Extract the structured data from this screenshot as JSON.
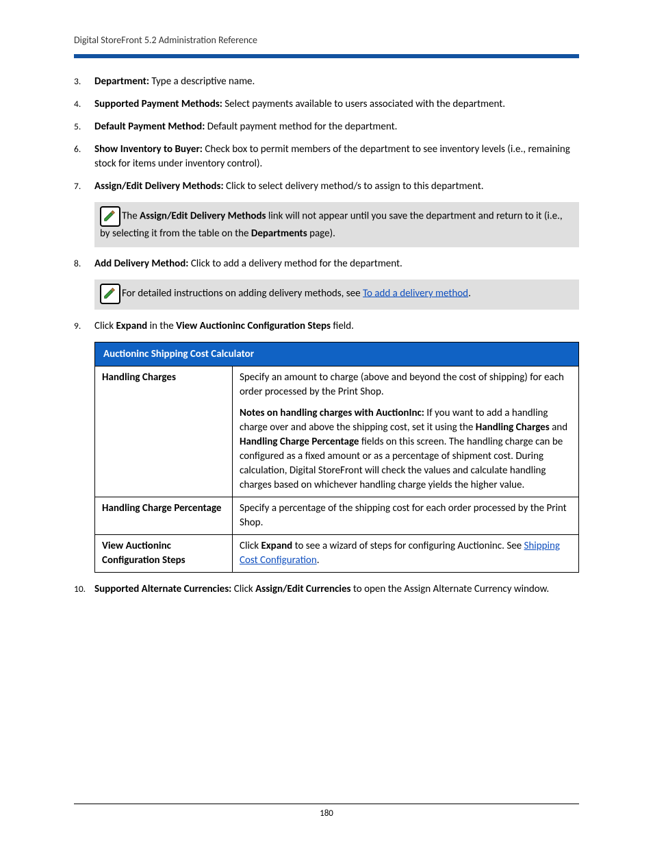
{
  "header": "Digital StoreFront 5.2 Administration Reference",
  "items": {
    "i3": {
      "num": "3.",
      "label": "Department:",
      "text": " Type a descriptive name."
    },
    "i4": {
      "num": "4.",
      "label": "Supported Payment Methods:",
      "text": " Select payments available to users associated with the department."
    },
    "i5": {
      "num": "5.",
      "label": "Default Payment Method:",
      "text": " Default payment method for the department."
    },
    "i6": {
      "num": "6.",
      "label": "Show Inventory to Buyer:",
      "text": " Check box to permit members of the department to see inventory levels (i.e., remaining stock for items under inventory control)."
    },
    "i7": {
      "num": "7.",
      "label": "Assign/Edit Delivery Methods:",
      "text": " Click to select delivery method/s to assign to this department."
    },
    "i8": {
      "num": "8.",
      "label": "Add Delivery Method:",
      "text": " Click to add a delivery method for the department."
    },
    "i9": {
      "num": "9.",
      "pre": "Click ",
      "b1": "Expand",
      "mid": " in the ",
      "b2": "View Auctioninc Configuration Steps",
      "post": " field."
    },
    "i10": {
      "num": "10.",
      "label": "Supported Alternate Currencies:",
      "mid": " Click ",
      "b2": "Assign/Edit Currencies",
      "post": " to open the Assign Alternate Currency window."
    }
  },
  "callout1": {
    "pre": "The ",
    "b1": "Assign/Edit Delivery Methods",
    "mid": " link will not appear until you save the department and return to it (i.e., by selecting it from the table on the ",
    "b2": "Departments",
    "post": " page)."
  },
  "callout2": {
    "pre": "For detailed instructions on adding delivery methods, see ",
    "link": "To add a delivery method",
    "post": "."
  },
  "table": {
    "title": "Auctioninc Shipping Cost Calculator",
    "r1": {
      "label": "Handling Charges",
      "p1": "Specify an amount to charge (above and beyond the cost of shipping) for each order processed by the Print Shop.",
      "p2_b1": "Notes on handling charges with AuctionInc:",
      "p2_t1": " If you want to add a handling charge over and above the shipping cost, set it using the ",
      "p2_b2": "Handling Charges",
      "p2_t2": " and ",
      "p2_b3": "Handling Charge Percentage",
      "p2_t3": " fields on this screen. The handling charge can be configured as a fixed amount or as a percentage of shipment cost. During calculation, Digital StoreFront will check the values and calculate handling charges based on whichever handling charge yields the higher value."
    },
    "r2": {
      "label": "Handling Charge Percentage",
      "text": "Specify a percentage of the shipping cost for each order processed by the Print Shop."
    },
    "r3": {
      "label": "View Auctioninc Configuration Steps",
      "pre": "Click ",
      "b1": "Expand",
      "mid": " to see a wizard of steps for configuring Auctioninc. See ",
      "link": "Shipping Cost Configuration",
      "post": "."
    }
  },
  "page_number": "180"
}
